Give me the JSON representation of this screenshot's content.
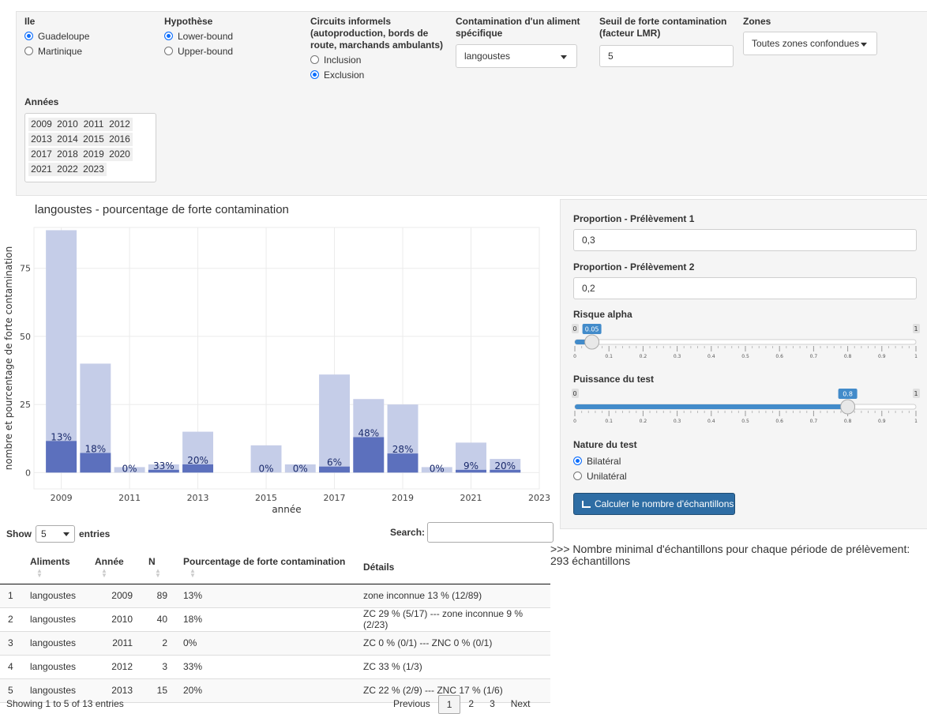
{
  "filters": {
    "ile": {
      "label": "Ile",
      "options": [
        "Guadeloupe",
        "Martinique"
      ],
      "selected": 0
    },
    "hypothese": {
      "label": "Hypothèse",
      "options": [
        "Lower-bound",
        "Upper-bound"
      ],
      "selected": 0
    },
    "circuits": {
      "label_lines": [
        "Circuits informels",
        "(autoproduction, bords de",
        "route, marchands ambulants)"
      ],
      "options": [
        "Inclusion",
        "Exclusion"
      ],
      "selected": 1
    },
    "contamination": {
      "label_lines": [
        "Contamination d'un aliment",
        "spécifique"
      ],
      "value": "langoustes"
    },
    "seuil": {
      "label_lines": [
        "Seuil de forte contamination",
        "(facteur LMR)"
      ],
      "value": "5"
    },
    "zones": {
      "label": "Zones",
      "value": "Toutes zones confondues"
    },
    "annees": {
      "label": "Années",
      "years": [
        "2009",
        "2010",
        "2011",
        "2012",
        "2013",
        "2014",
        "2015",
        "2016",
        "2017",
        "2018",
        "2019",
        "2020",
        "2021",
        "2022",
        "2023"
      ]
    }
  },
  "chart_data": {
    "type": "bar",
    "title": "langoustes - pourcentage de forte contamination",
    "xlabel": "année",
    "ylabel": "nombre et pourcentage de forte contamination",
    "xlim": [
      2008.2,
      2023
    ],
    "ylim": [
      -6,
      90
    ],
    "xticks": [
      2009,
      2011,
      2013,
      2015,
      2017,
      2019,
      2021,
      2023
    ],
    "yticks": [
      0,
      25,
      50,
      75
    ],
    "grid": true,
    "colors": {
      "total": "#c5cde8",
      "forte": "#5c70bd",
      "label": "#1a2a6c"
    },
    "series": [
      {
        "values": [
          89,
          40,
          2,
          3,
          15,
          0,
          10,
          3,
          36,
          27,
          25,
          2,
          11,
          5
        ]
      },
      {
        "values": [
          11.6,
          7.2,
          0,
          1,
          3,
          0,
          0,
          0,
          2.2,
          13,
          7,
          0,
          1,
          1
        ]
      }
    ],
    "x": [
      2009,
      2010,
      2011,
      2012,
      2013,
      2014,
      2015,
      2016,
      2017,
      2018,
      2019,
      2020,
      2021,
      2022
    ],
    "labels": [
      {
        "x": 2009,
        "text": "13%"
      },
      {
        "x": 2010,
        "text": "18%"
      },
      {
        "x": 2011,
        "text": "0%"
      },
      {
        "x": 2012,
        "text": "33%"
      },
      {
        "x": 2013,
        "text": "20%"
      },
      {
        "x": 2015,
        "text": "0%"
      },
      {
        "x": 2016,
        "text": "0%"
      },
      {
        "x": 2017,
        "text": "6%"
      },
      {
        "x": 2018,
        "text": "48%"
      },
      {
        "x": 2019,
        "text": "28%"
      },
      {
        "x": 2020,
        "text": "0%"
      },
      {
        "x": 2021,
        "text": "9%"
      },
      {
        "x": 2022,
        "text": "20%"
      }
    ]
  },
  "side": {
    "p1_label": "Proportion - Prélèvement 1",
    "p1_value": "0,3",
    "p2_label": "Proportion - Prélèvement 2",
    "p2_value": "0,2",
    "alpha": {
      "label": "Risque alpha",
      "min": "0",
      "max": "1",
      "value": 0.05,
      "value_text": "0.05"
    },
    "power": {
      "label": "Puissance du test",
      "min": "0",
      "max": "1",
      "value": 0.8,
      "value_text": "0.8"
    },
    "ticks": [
      "0",
      "0.1",
      "0.2",
      "0.3",
      "0.4",
      "0.5",
      "0.6",
      "0.7",
      "0.8",
      "0.9",
      "1"
    ],
    "nature": {
      "label": "Nature du test",
      "options": [
        "Bilatéral",
        "Unilatéral"
      ],
      "selected": 0
    },
    "button": "Calculer le nombre d'échantillons"
  },
  "result": {
    "line1": ">>> Nombre minimal d'échantillons pour chaque période de prélèvement:",
    "line2": "293 échantillons"
  },
  "table": {
    "show": "Show",
    "entries_value": "5",
    "entries": "entries",
    "search": "Search:",
    "columns": [
      "",
      "Aliments",
      "Année",
      "N",
      "Pourcentage de forte contamination",
      "Détails"
    ],
    "rows": [
      [
        "1",
        "langoustes",
        "2009",
        "89",
        "13%",
        "zone inconnue 13 % (12/89)"
      ],
      [
        "2",
        "langoustes",
        "2010",
        "40",
        "18%",
        "ZC 29 % (5/17) --- zone inconnue 9 % (2/23)"
      ],
      [
        "3",
        "langoustes",
        "2011",
        "2",
        "0%",
        "ZC 0 % (0/1) --- ZNC 0 % (0/1)"
      ],
      [
        "4",
        "langoustes",
        "2012",
        "3",
        "33%",
        "ZC 33 % (1/3)"
      ],
      [
        "5",
        "langoustes",
        "2013",
        "15",
        "20%",
        "ZC 22 % (2/9) --- ZNC 17 % (1/6)"
      ]
    ],
    "info": "Showing 1 to 5 of 13 entries",
    "pager": [
      "Previous",
      "1",
      "2",
      "3",
      "Next"
    ]
  }
}
